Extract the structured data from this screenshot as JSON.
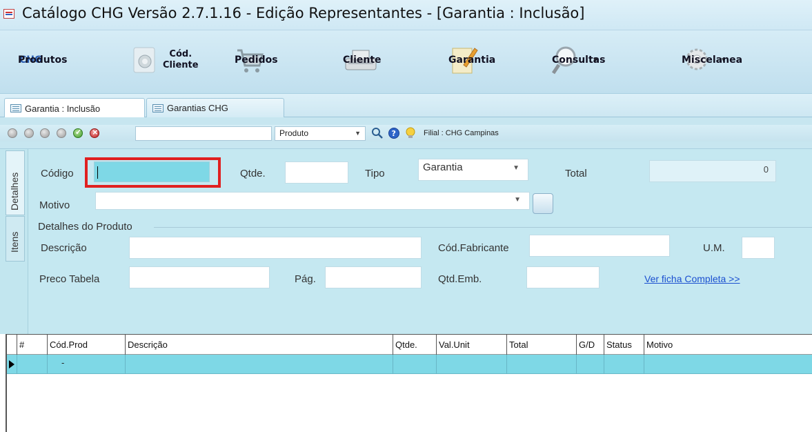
{
  "window": {
    "title": "Catálogo CHG Versão 2.7.1.16 - Edição Representantes - [Garantia : Inclusão]"
  },
  "ribbon": {
    "produtos": "Produtos",
    "cod_cliente_line1": "Cód.",
    "cod_cliente_line2": "Cliente",
    "pedidos": "Pedidos",
    "cliente": "Cliente",
    "garantia": "Garantia",
    "consultas": "Consultas",
    "miscelanea": "Miscelanea",
    "chg_logo": "CHG"
  },
  "tabs": [
    {
      "label": "Garantia : Inclusão"
    },
    {
      "label": "Garantias CHG"
    }
  ],
  "toolbar": {
    "search_value": "",
    "filter_selected": "Produto",
    "filial": "Filial : CHG Campinas"
  },
  "side_tabs": {
    "detalhes": "Detalhes",
    "itens": "Itens"
  },
  "form": {
    "codigo_label": "Código",
    "codigo_value": "",
    "qtde_label": "Qtde.",
    "qtde_value": "",
    "tipo_label": "Tipo",
    "tipo_value": "Garantia",
    "total_label": "Total",
    "total_value": "0",
    "motivo_label": "Motivo",
    "motivo_value": "",
    "group_title": "Detalhes do Produto",
    "descricao_label": "Descrição",
    "cod_fabricante_label": "Cód.Fabricante",
    "um_label": "U.M.",
    "preco_tabela_label": "Preco Tabela",
    "pag_label": "Pág.",
    "qtd_emb_label": "Qtd.Emb.",
    "ver_ficha_link": "Ver ficha Completa >>"
  },
  "grid": {
    "columns": [
      "#",
      "Cód.Prod",
      "Descrição",
      "Qtde.",
      "Val.Unit",
      "Total",
      "G/D",
      "Status",
      "Motivo"
    ],
    "rows": [
      {
        "cod_prod": "-"
      }
    ]
  },
  "colors": {
    "highlight_border": "#e02020",
    "selected_field": "#7ed8e6",
    "panel_bg": "#c5e8f1",
    "link": "#1a4fd0"
  },
  "icons": [
    "app-icon",
    "cod-cliente-icon",
    "cart-icon",
    "cash-register-icon",
    "notepad-icon",
    "magnifier-icon",
    "gear-icon",
    "search-icon",
    "help-icon",
    "lightbulb-icon"
  ]
}
